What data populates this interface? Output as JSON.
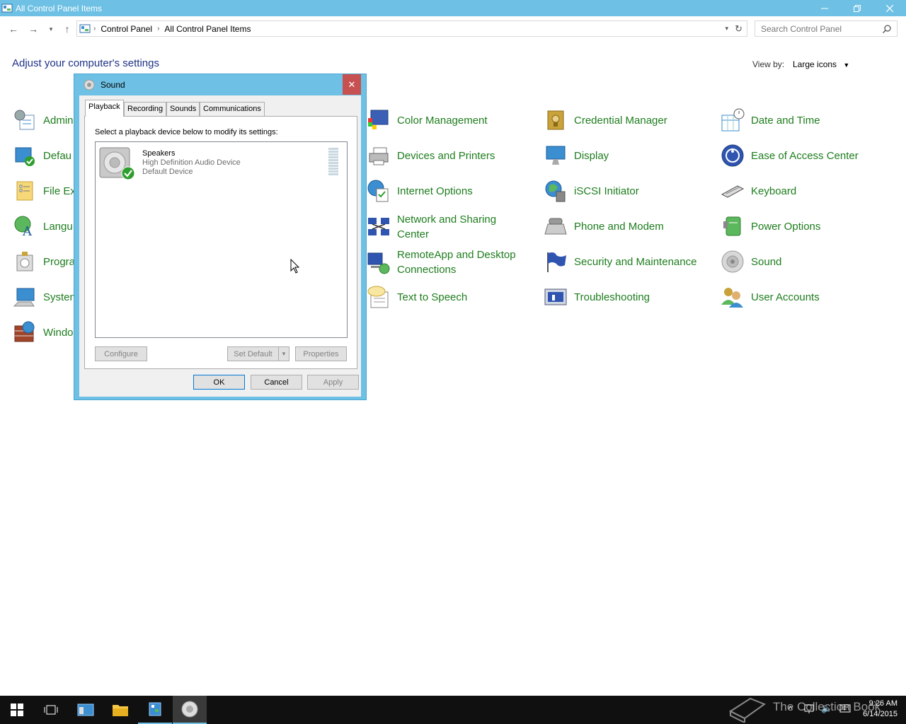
{
  "window": {
    "title": "All Control Panel Items"
  },
  "address": {
    "crumbs": [
      "Control Panel",
      "All Control Panel Items"
    ],
    "search_placeholder": "Search Control Panel"
  },
  "heading": "Adjust your computer's settings",
  "view_by": {
    "label": "View by:",
    "value": "Large icons"
  },
  "items_left_partial": [
    "Admin",
    "Defau",
    "File Ex",
    "Langu",
    "Progra",
    "Systen",
    "Windo"
  ],
  "items": {
    "col1": [
      "Color Management",
      "Devices and Printers",
      "Internet Options",
      "Network and Sharing\nCenter",
      "RemoteApp and Desktop\nConnections",
      "Text to Speech"
    ],
    "col2": [
      "Credential Manager",
      "Display",
      "iSCSI Initiator",
      "Phone and Modem",
      "Security and Maintenance",
      "Troubleshooting"
    ],
    "col3": [
      "Date and Time",
      "Ease of Access Center",
      "Keyboard",
      "Power Options",
      "Sound",
      "User Accounts"
    ]
  },
  "dialog": {
    "title": "Sound",
    "tabs": [
      "Playback",
      "Recording",
      "Sounds",
      "Communications"
    ],
    "instruction": "Select a playback device below to modify its settings:",
    "device": {
      "name": "Speakers",
      "desc": "High Definition Audio Device",
      "status": "Default Device"
    },
    "buttons": {
      "configure": "Configure",
      "set_default": "Set Default",
      "properties": "Properties",
      "ok": "OK",
      "cancel": "Cancel",
      "apply": "Apply"
    }
  },
  "tray": {
    "time": "9:26 AM",
    "date": "6/14/2015",
    "watermark": "The Collection Book"
  }
}
